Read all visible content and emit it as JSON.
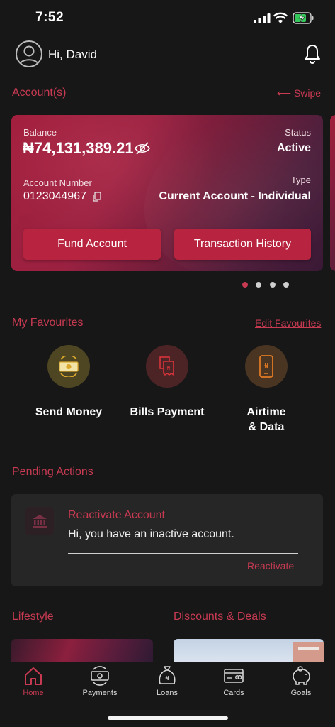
{
  "status_bar": {
    "time": "7:52"
  },
  "header": {
    "greeting": "Hi, David"
  },
  "accounts": {
    "title": "Account(s)",
    "swipe_hint": "⟵ Swipe"
  },
  "account_card": {
    "balance_label": "Balance",
    "balance": "₦74,131,389.21",
    "status_label": "Status",
    "status": "Active",
    "account_number_label": "Account Number",
    "account_number": "0123044967",
    "type_label": "Type",
    "type": "Current Account - Individual",
    "fund_button": "Fund Account",
    "history_button": "Transaction History"
  },
  "pager": {
    "count": 4,
    "active_index": 0
  },
  "favourites": {
    "title": "My Favourites",
    "edit_link": "Edit Favourites",
    "items": [
      {
        "label_line1": "Send Money",
        "label_line2": "",
        "icon": "money-icon",
        "color": "#4e4623"
      },
      {
        "label_line1": "Bills Payment",
        "label_line2": "",
        "icon": "receipt-icon",
        "color": "#4c2426"
      },
      {
        "label_line1": "Airtime",
        "label_line2": "& Data",
        "icon": "phone-icon",
        "color": "#4a3523"
      }
    ]
  },
  "pending": {
    "title": "Pending Actions",
    "card_title": "Reactivate Account",
    "message": "Hi, you have an inactive account.",
    "action": "Reactivate"
  },
  "lifestyle": {
    "title": "Lifestyle"
  },
  "discounts": {
    "title": "Discounts & Deals"
  },
  "tabs": [
    {
      "label": "Home",
      "icon": "home-icon",
      "active": true
    },
    {
      "label": "Payments",
      "icon": "payments-icon",
      "active": false
    },
    {
      "label": "Loans",
      "icon": "loans-icon",
      "active": false
    },
    {
      "label": "Cards",
      "icon": "cards-icon",
      "active": false
    },
    {
      "label": "Goals",
      "icon": "goals-icon",
      "active": false
    }
  ],
  "colors": {
    "accent": "#c83a52",
    "background": "#171717",
    "button": "#b8243f"
  }
}
